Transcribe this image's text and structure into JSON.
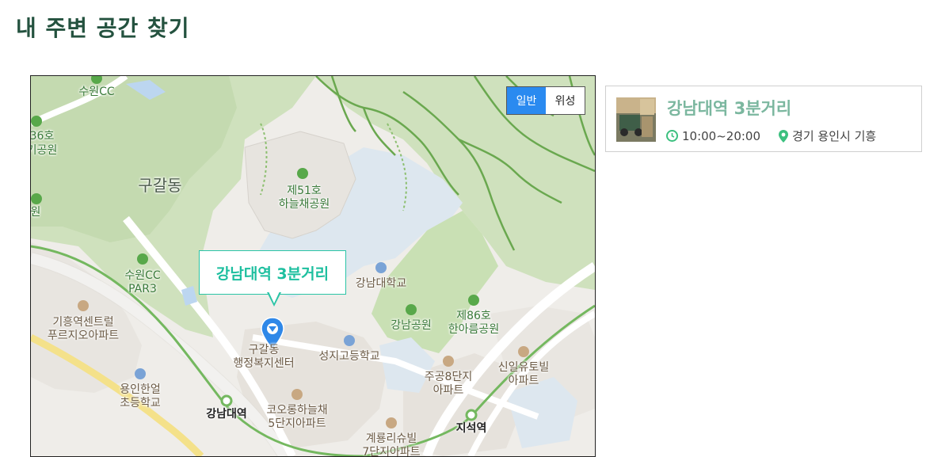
{
  "page": {
    "title": "내 주변 공간 찾기"
  },
  "map": {
    "toggle": {
      "normal_label": "일반",
      "satellite_label": "위성",
      "selected": "일반"
    },
    "marker_callout": "강남대역 3분거리",
    "labels": {
      "suwon_cc": "수원CC",
      "park36_a": "36호",
      "park36_b": "기공원",
      "park_partial": "원",
      "gugal_dong": "구갈동",
      "park51_a": "제51호",
      "park51_b": "하늘채공원",
      "suwon_cc_par3_a": "수원CC",
      "suwon_cc_par3_b": "PAR3",
      "kangnam_univ": "강남대학교",
      "kangnam_park": "강남공원",
      "park86_a": "제86호",
      "park86_b": "한아름공원",
      "giheung_apt_a": "기흥역센트럴",
      "giheung_apt_b": "푸르지오아파트",
      "gugal_office_a": "구갈동",
      "gugal_office_b": "행정복지센터",
      "seongji_high": "성지고등학교",
      "jugong8_a": "주공8단지",
      "jugong8_b": "아파트",
      "sinil_a": "신일유토빌",
      "sinil_b": "아파트",
      "yongin_elem_a": "용인한얼",
      "yongin_elem_b": "초등학교",
      "kangnam_station": "강남대역",
      "koaroong_a": "코오롱하늘채",
      "koaroong_b": "5단지아파트",
      "gyeryong_a": "계룡리슈빌",
      "gyeryong_b": "7단지아파트",
      "jiseok_station": "지석역"
    }
  },
  "place": {
    "name": "강남대역 3분거리",
    "hours": "10:00~20:00",
    "location": "경기 용인시 기흥"
  },
  "colors": {
    "title": "#24523f",
    "accent": "#1dbf9f",
    "place_name": "#7bb79f",
    "toggle_active": "#2a8af0"
  }
}
